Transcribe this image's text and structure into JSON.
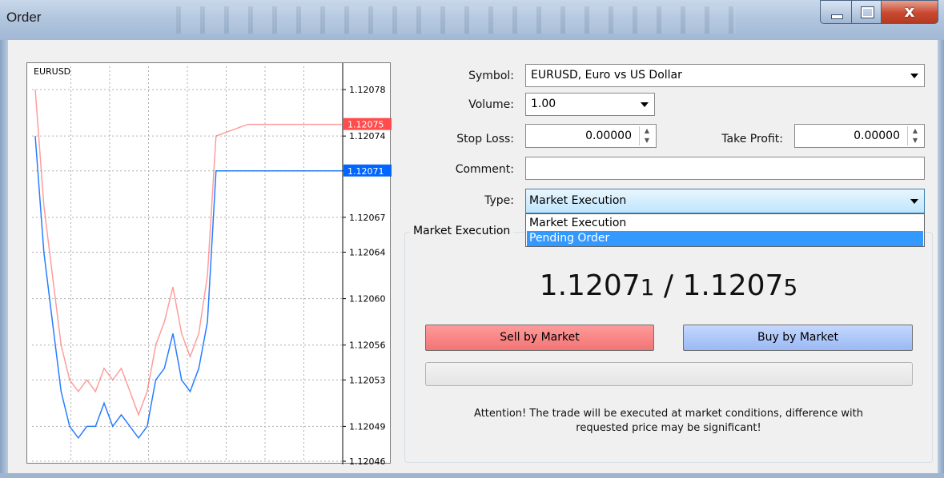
{
  "window": {
    "title": "Order",
    "close_glyph": "x"
  },
  "chart": {
    "symbol": "EURUSD",
    "price_labels": [
      "1.12078",
      "1.12074",
      "1.12071",
      "1.12067",
      "1.12064",
      "1.12060",
      "1.12056",
      "1.12053",
      "1.12049",
      "1.12046"
    ],
    "ask_tag": "1.12075",
    "bid_tag": "1.12071",
    "ask_color": "#ff4d4d",
    "bid_color": "#0066ff"
  },
  "chart_data": {
    "type": "line",
    "title": "EURUSD",
    "ylim": [
      1.12046,
      1.1208
    ],
    "series": [
      {
        "values": [
          1.12078,
          1.12068,
          1.12062,
          1.12056,
          1.12053,
          1.12052,
          1.12053,
          1.12052,
          1.12054,
          1.12053,
          1.12054,
          1.12052,
          1.1205,
          1.12052,
          1.12056,
          1.12058,
          1.12061,
          1.12057,
          1.12055,
          1.12057,
          1.12062,
          1.12074,
          1.12075,
          1.12075,
          1.12075,
          1.12075
        ]
      },
      {
        "values": [
          1.12074,
          1.12064,
          1.12058,
          1.12052,
          1.12049,
          1.12048,
          1.12049,
          1.12049,
          1.12051,
          1.12049,
          1.1205,
          1.12049,
          1.12048,
          1.12049,
          1.12053,
          1.12054,
          1.12057,
          1.12053,
          1.12052,
          1.12054,
          1.12058,
          1.12071,
          1.12071,
          1.12071,
          1.12071,
          1.12071
        ]
      }
    ]
  },
  "form": {
    "symbol_label": "Symbol:",
    "symbol_value": "EURUSD, Euro vs US Dollar",
    "volume_label": "Volume:",
    "volume_value": "1.00",
    "stoploss_label": "Stop Loss:",
    "stoploss_value": "0.00000",
    "takeprofit_label": "Take Profit:",
    "takeprofit_value": "0.00000",
    "comment_label": "Comment:",
    "comment_value": "",
    "type_label": "Type:",
    "type_value": "Market Execution",
    "type_options": [
      "Market Execution",
      "Pending Order"
    ],
    "type_highlighted": "Pending Order"
  },
  "market": {
    "group_caption": "Market Execution",
    "bid_main": "1.1207",
    "bid_last": "1",
    "separator": " / ",
    "ask_main": "1.1207",
    "ask_last": "5",
    "sell_label": "Sell by Market",
    "buy_label": "Buy by Market",
    "attention_line1": "Attention! The trade will be executed at market conditions, difference with",
    "attention_line2": "requested price may be significant!"
  }
}
